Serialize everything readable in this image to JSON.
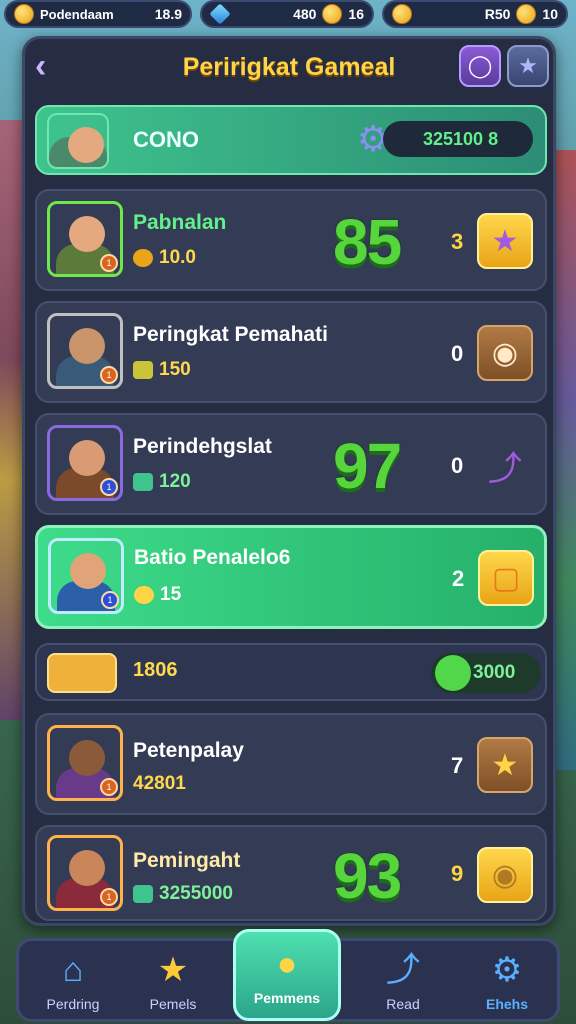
{
  "topbar": {
    "stat1": {
      "label": "Podendaam",
      "value": "18.9",
      "icon": "coin-icon"
    },
    "stat2": {
      "label": "480",
      "value": "16",
      "icon": "gem-icon"
    },
    "stat3": {
      "label": "R50",
      "value": "10",
      "icon": "coin-icon"
    }
  },
  "header": {
    "title": "Peririgkat Gameal",
    "back_icon": "chevron-left-icon",
    "btn1_icon": "badge-icon",
    "btn2_icon": "star-icon"
  },
  "me": {
    "name": "CONO",
    "score": "325100 8"
  },
  "rows": [
    {
      "name": "Pabnalan",
      "score": "10.0",
      "big": "85",
      "rank": "3",
      "badge": "star-icon"
    },
    {
      "name": "Peringkat Pemahati",
      "score": "150",
      "big": "",
      "rank": "0",
      "badge": "bean-icon"
    },
    {
      "name": "Perindehgslat",
      "score": "120",
      "big": "97",
      "rank": "0",
      "badge": "arrow-up-icon"
    },
    {
      "name": "Batio Penalelo6",
      "score": "15",
      "big": "",
      "rank": "2",
      "badge": "cube-icon"
    },
    {
      "name": "Petenpalay",
      "score": "42801",
      "big": "",
      "rank": "7",
      "badge": "star-icon"
    },
    {
      "name": "Pemingaht",
      "score": "3255000",
      "big": "93",
      "rank": "9",
      "badge": "bean-icon"
    }
  ],
  "summary": {
    "left": "1806",
    "right": "3000"
  },
  "nav": [
    {
      "label": "Perdring",
      "icon": "home-icon"
    },
    {
      "label": "Pemels",
      "icon": "star-icon"
    },
    {
      "label": "Pemmens",
      "icon": "coin-icon"
    },
    {
      "label": "Read",
      "icon": "arrow-icon"
    },
    {
      "label": "Ehehs",
      "icon": "gear-icon"
    }
  ],
  "colors": {
    "accent": "#ffd447",
    "panel": "#262d42",
    "highlight": "#3ddc8a"
  }
}
